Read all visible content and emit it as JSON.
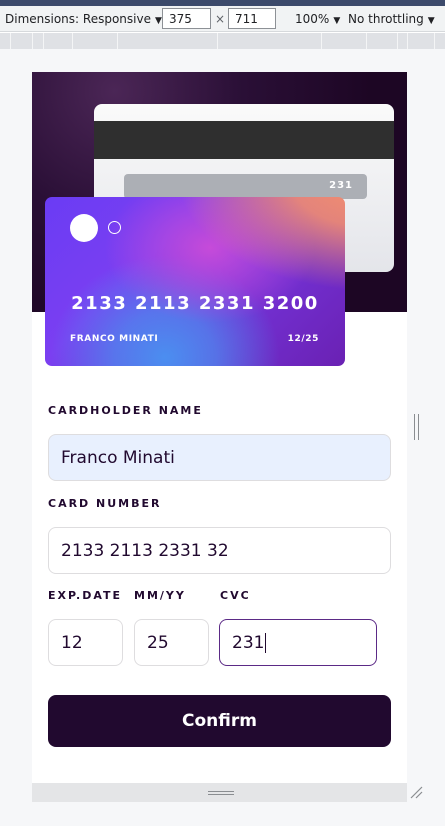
{
  "devtools": {
    "dimensions_label": "Dimensions: Responsive",
    "width": "375",
    "height": "711",
    "times": "×",
    "zoom": "100%",
    "throttling": "No throttling",
    "caret": "▼"
  },
  "card_back": {
    "cvc": "231"
  },
  "card_front": {
    "number": "2133 2113 2331 3200",
    "name": "FRANCO MINATI",
    "expiry": "12/25"
  },
  "form": {
    "cardholder_label": "CARDHOLDER NAME",
    "cardholder_value": "Franco Minati",
    "number_label": "CARD NUMBER",
    "number_value": "2133 2113 2331 32",
    "exp_label": "EXP.DATE",
    "mmyy_label": "MM/YY",
    "cvc_label": "CVC",
    "month_value": "12",
    "year_value": "25",
    "cvc_value": "231",
    "confirm_label": "Confirm"
  }
}
